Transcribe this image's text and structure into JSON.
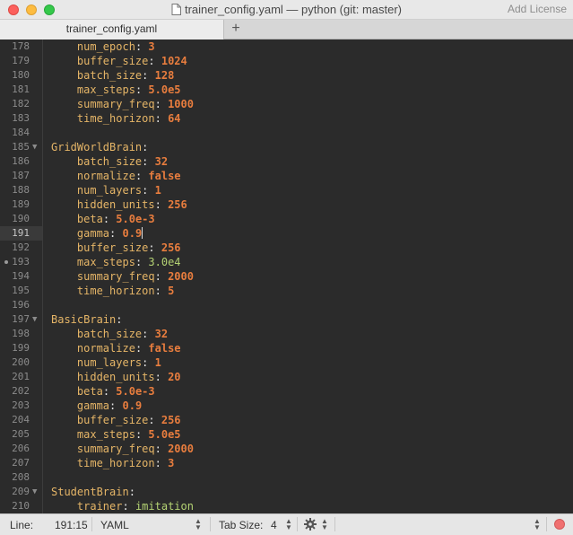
{
  "window": {
    "title": "trainer_config.yaml — python (git: master)",
    "license_label": "Add License"
  },
  "tabs": [
    {
      "label": "trainer_config.yaml"
    }
  ],
  "tab_add_label": "+",
  "editor": {
    "current_line": "191",
    "lines": [
      {
        "num": "178",
        "indent": "    ",
        "key": "num_epoch",
        "val": "3"
      },
      {
        "num": "179",
        "indent": "    ",
        "key": "buffer_size",
        "val": "1024"
      },
      {
        "num": "180",
        "indent": "    ",
        "key": "batch_size",
        "val": "128"
      },
      {
        "num": "181",
        "indent": "    ",
        "key": "max_steps",
        "val": "5.0e5"
      },
      {
        "num": "182",
        "indent": "    ",
        "key": "summary_freq",
        "val": "1000"
      },
      {
        "num": "183",
        "indent": "    ",
        "key": "time_horizon",
        "val": "64"
      },
      {
        "num": "184",
        "indent": "",
        "key": "",
        "val": ""
      },
      {
        "num": "185",
        "indent": "",
        "key": "GridWorldBrain",
        "val": "",
        "fold": true
      },
      {
        "num": "186",
        "indent": "    ",
        "key": "batch_size",
        "val": "32"
      },
      {
        "num": "187",
        "indent": "    ",
        "key": "normalize",
        "val": "false"
      },
      {
        "num": "188",
        "indent": "    ",
        "key": "num_layers",
        "val": "1"
      },
      {
        "num": "189",
        "indent": "    ",
        "key": "hidden_units",
        "val": "256"
      },
      {
        "num": "190",
        "indent": "    ",
        "key": "beta",
        "val": "5.0e-3"
      },
      {
        "num": "191",
        "indent": "    ",
        "key": "gamma",
        "val": "0.9",
        "cursor": true
      },
      {
        "num": "192",
        "indent": "    ",
        "key": "buffer_size",
        "val": "256"
      },
      {
        "num": "193",
        "indent": "    ",
        "key": "max_steps",
        "val": "3.0e4",
        "dot": true,
        "valclass": "s"
      },
      {
        "num": "194",
        "indent": "    ",
        "key": "summary_freq",
        "val": "2000"
      },
      {
        "num": "195",
        "indent": "    ",
        "key": "time_horizon",
        "val": "5"
      },
      {
        "num": "196",
        "indent": "",
        "key": "",
        "val": ""
      },
      {
        "num": "197",
        "indent": "",
        "key": "BasicBrain",
        "val": "",
        "fold": true
      },
      {
        "num": "198",
        "indent": "    ",
        "key": "batch_size",
        "val": "32"
      },
      {
        "num": "199",
        "indent": "    ",
        "key": "normalize",
        "val": "false"
      },
      {
        "num": "200",
        "indent": "    ",
        "key": "num_layers",
        "val": "1"
      },
      {
        "num": "201",
        "indent": "    ",
        "key": "hidden_units",
        "val": "20"
      },
      {
        "num": "202",
        "indent": "    ",
        "key": "beta",
        "val": "5.0e-3"
      },
      {
        "num": "203",
        "indent": "    ",
        "key": "gamma",
        "val": "0.9"
      },
      {
        "num": "204",
        "indent": "    ",
        "key": "buffer_size",
        "val": "256"
      },
      {
        "num": "205",
        "indent": "    ",
        "key": "max_steps",
        "val": "5.0e5"
      },
      {
        "num": "206",
        "indent": "    ",
        "key": "summary_freq",
        "val": "2000"
      },
      {
        "num": "207",
        "indent": "    ",
        "key": "time_horizon",
        "val": "3"
      },
      {
        "num": "208",
        "indent": "",
        "key": "",
        "val": ""
      },
      {
        "num": "209",
        "indent": "",
        "key": "StudentBrain",
        "val": "",
        "fold": true
      },
      {
        "num": "210",
        "indent": "    ",
        "key": "trainer",
        "val": "imitation",
        "valclass": "s"
      }
    ]
  },
  "statusbar": {
    "line_label": "Line:",
    "position": "191:15",
    "syntax": "YAML",
    "tab_size_label": "Tab Size:",
    "tab_size": "4"
  },
  "colors": {
    "key": "#e5b567",
    "number": "#e87d3e",
    "string": "#b4d273",
    "background": "#2b2b2b"
  }
}
